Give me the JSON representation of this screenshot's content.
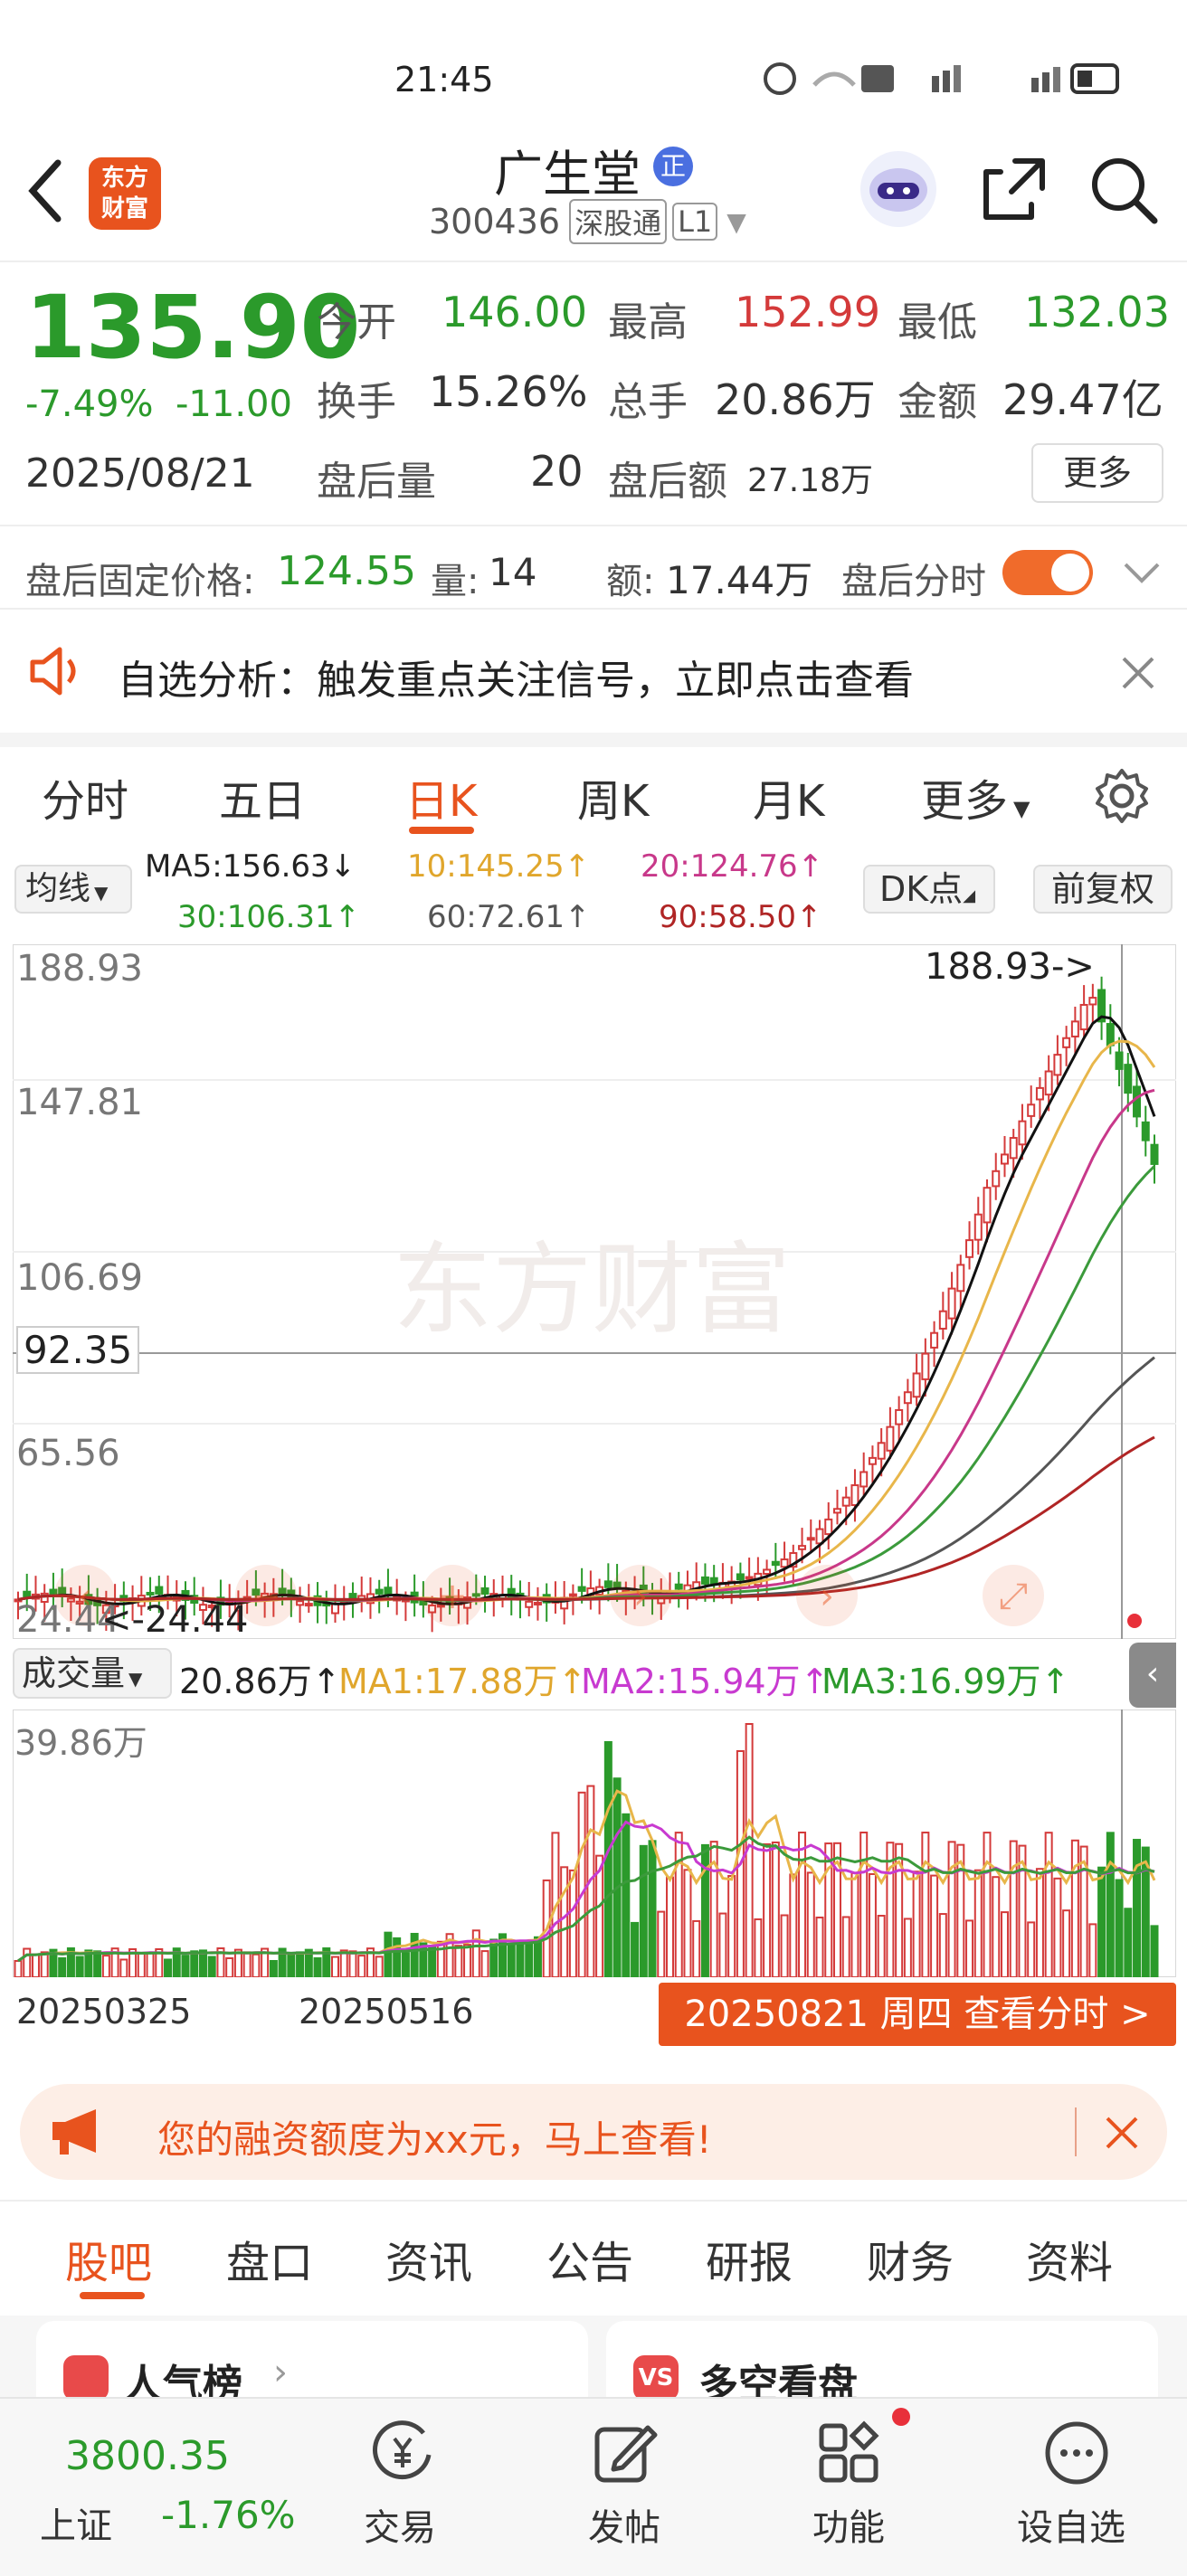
{
  "status": {
    "time": "21:45"
  },
  "header": {
    "stock_name": "广生堂",
    "stock_code": "300436",
    "exchange_tag": "深股通",
    "level_tag": "L1",
    "logo_text_line1": "东方",
    "logo_text_line2": "财富"
  },
  "quote": {
    "price": "135.90",
    "change_pct": "-7.49%",
    "change": "-11.00",
    "date": "2025/08/21",
    "open_label": "今开",
    "open": "146.00",
    "high_label": "最高",
    "high": "152.99",
    "low_label": "最低",
    "low": "132.03",
    "turnover_label": "换手",
    "turnover": "15.26%",
    "volume_label": "总手",
    "volume": "20.86万",
    "amount_label": "金额",
    "amount": "29.47亿",
    "ah_vol_label": "盘后量",
    "ah_vol": "20",
    "ah_amt_label": "盘后额",
    "ah_amt": "27.18万",
    "more_label": "更多"
  },
  "after_hours": {
    "price_label": "盘后固定价格:",
    "price": "124.55",
    "vol_label": "量:",
    "vol": "14",
    "amt_label": "额:",
    "amt": "17.44万",
    "toggle_label": "盘后分时"
  },
  "banner": {
    "text": "自选分析：触发重点关注信号，立即点击查看"
  },
  "tabs": {
    "items": [
      "分时",
      "五日",
      "日K",
      "周K",
      "月K",
      "更多"
    ],
    "active": "日K"
  },
  "ma_bar": {
    "selector": "均线",
    "ma5": "MA5:156.63↓",
    "ma10": "10:145.25↑",
    "ma20": "20:124.76↑",
    "ma30": "30:106.31↑",
    "ma60": "60:72.61↑",
    "ma90": "90:58.50↑",
    "dk_label": "DK点",
    "adjust_label": "前复权"
  },
  "kline": {
    "y_labels": [
      "188.93",
      "147.81",
      "106.69",
      "65.56",
      "24.44"
    ],
    "crosshair_price": "92.35",
    "max_marker": "188.93->",
    "min_marker": "<-24.44",
    "watermark": "东方财富",
    "colors": {
      "up": "#d43a3a",
      "down": "#2b9a2b",
      "ma5": "#111111",
      "ma10": "#e8b64a",
      "ma20": "#c8388a",
      "ma30": "#3b9a3b",
      "ma60": "#555555",
      "ma90": "#b02525"
    }
  },
  "volume_bar": {
    "selector": "成交量",
    "value": "20.86万↑",
    "ma1": "MA1:17.88万↑",
    "ma2": "MA2:15.94万↑",
    "ma3": "MA3:16.99万↑",
    "max_label": "39.86万"
  },
  "dates": {
    "d1": "20250325",
    "d2": "20250516",
    "action": "20250821 周四 查看分时 >"
  },
  "promo": {
    "text": "您的融资额度为xx元，马上查看!"
  },
  "sub_tabs": {
    "items": [
      "股吧",
      "盘口",
      "资讯",
      "公告",
      "研报",
      "财务",
      "资料"
    ],
    "active": "股吧"
  },
  "cards": {
    "left": "人气榜",
    "right": "多空看盘"
  },
  "bottom": {
    "index_value": "3800.35",
    "index_name": "上证",
    "index_change": "-1.76%",
    "nav": [
      "交易",
      "发帖",
      "功能",
      "设自选"
    ]
  }
}
